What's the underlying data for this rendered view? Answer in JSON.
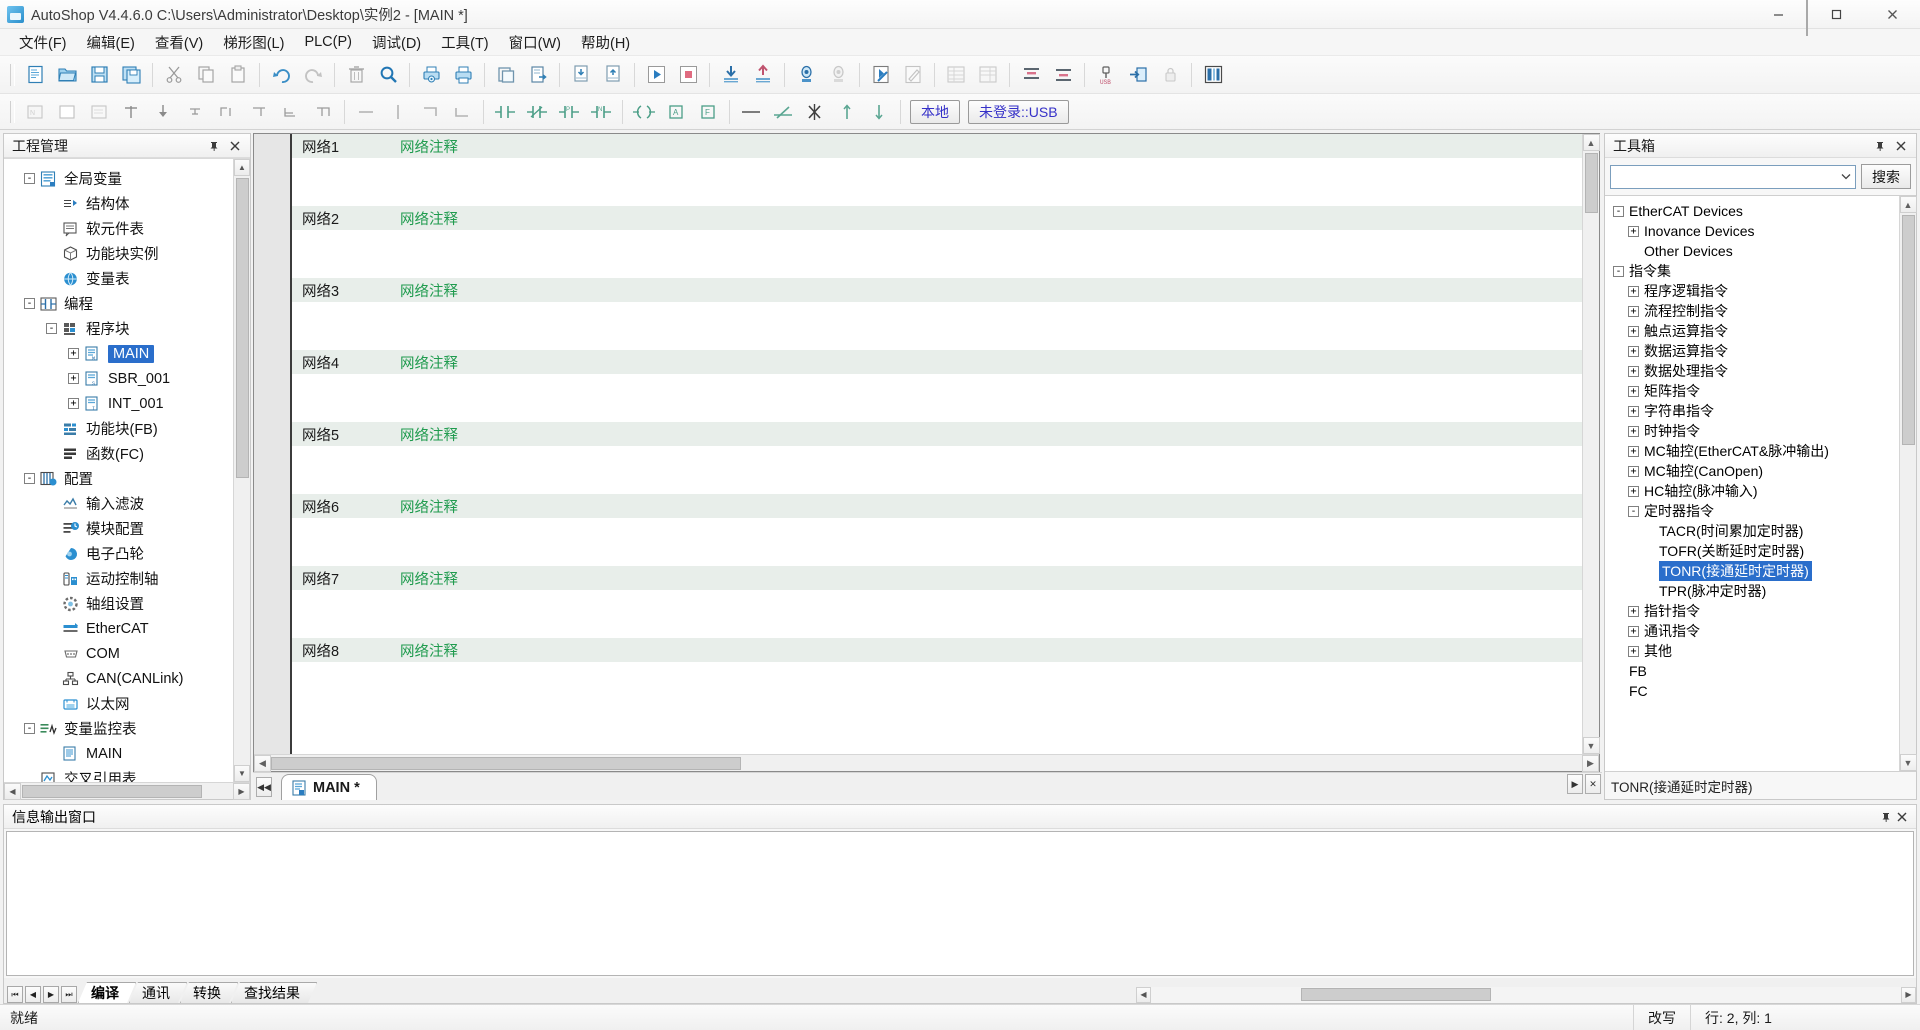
{
  "window": {
    "title": "AutoShop V4.4.6.0  C:\\Users\\Administrator\\Desktop\\实例2 - [MAIN *]",
    "minimize": "—",
    "maximize": "▢",
    "close": "✕"
  },
  "menubar": [
    {
      "label": "文件(F)"
    },
    {
      "label": "编辑(E)"
    },
    {
      "label": "查看(V)"
    },
    {
      "label": "梯形图(L)"
    },
    {
      "label": "PLC(P)"
    },
    {
      "label": "调试(D)"
    },
    {
      "label": "工具(T)"
    },
    {
      "label": "窗口(W)"
    },
    {
      "label": "帮助(H)"
    }
  ],
  "toolbar_main": {
    "icons": [
      "new-file-icon",
      "open-folder-icon",
      "save-icon",
      "save-all-icon",
      "cut-icon",
      "copy-icon",
      "paste-icon",
      "undo-icon",
      "redo-icon",
      "delete-icon",
      "find-icon",
      "print-preview-icon",
      "print-icon",
      "copy-window-icon",
      "export-icon",
      "download-doc-icon",
      "upload-doc-icon",
      "run-icon",
      "stop-icon",
      "download-plc-icon",
      "upload-plc-icon",
      "monitor-icon",
      "monitor-off-icon",
      "compile-icon",
      "edit-mode-icon",
      "table-left-icon",
      "table-right-icon",
      "align-top-icon",
      "align-bottom-icon",
      "usb-connect-icon",
      "login-icon",
      "lock-icon",
      "layout-icon"
    ]
  },
  "toolbar_ladder": {
    "icons": [
      "network-view-icon",
      "block-view-icon",
      "instruction-view-icon",
      "insert-row-icon",
      "insert-down-icon",
      "insert-branch-icon",
      "branch-up-icon",
      "branch-up2-icon",
      "branch-down-icon",
      "branch-down2-icon",
      "hline-icon",
      "vline-icon",
      "corner-icon",
      "corner2-icon",
      "contact-no-icon",
      "contact-nc-icon",
      "contact-p-icon",
      "contact-n-icon",
      "coil-icon",
      "coil-set-icon",
      "box-icon",
      "box-a-icon",
      "box-f-icon",
      "line-icon",
      "del-line-icon",
      "del-branch-icon",
      "arrow-up-icon",
      "arrow-down-icon"
    ],
    "local_button": "本地",
    "login_button": "未登录::USB"
  },
  "project_panel": {
    "title": "工程管理",
    "pin_icon": "pin-icon",
    "close_icon": "close-icon",
    "tree": [
      {
        "label": "全局变量",
        "indent": 0,
        "toggle": "-",
        "icon": "global-var-icon"
      },
      {
        "label": "结构体",
        "indent": 1,
        "toggle": "",
        "icon": "struct-icon"
      },
      {
        "label": "软元件表",
        "indent": 1,
        "toggle": "",
        "icon": "device-table-icon"
      },
      {
        "label": "功能块实例",
        "indent": 1,
        "toggle": "",
        "icon": "fb-instance-icon"
      },
      {
        "label": "变量表",
        "indent": 1,
        "toggle": "",
        "icon": "var-table-icon"
      },
      {
        "label": "编程",
        "indent": 0,
        "toggle": "-",
        "icon": "programming-icon"
      },
      {
        "label": "程序块",
        "indent": 1,
        "toggle": "-",
        "icon": "program-block-icon"
      },
      {
        "label": "MAIN",
        "indent": 2,
        "toggle": "+",
        "icon": "main-pou-icon",
        "selected": true
      },
      {
        "label": "SBR_001",
        "indent": 2,
        "toggle": "+",
        "icon": "sbr-pou-icon"
      },
      {
        "label": "INT_001",
        "indent": 2,
        "toggle": "+",
        "icon": "int-pou-icon"
      },
      {
        "label": "功能块(FB)",
        "indent": 1,
        "toggle": "",
        "icon": "fb-icon"
      },
      {
        "label": "函数(FC)",
        "indent": 1,
        "toggle": "",
        "icon": "fc-icon"
      },
      {
        "label": "配置",
        "indent": 0,
        "toggle": "-",
        "icon": "config-icon"
      },
      {
        "label": "输入滤波",
        "indent": 1,
        "toggle": "",
        "icon": "input-filter-icon"
      },
      {
        "label": "模块配置",
        "indent": 1,
        "toggle": "",
        "icon": "module-config-icon"
      },
      {
        "label": "电子凸轮",
        "indent": 1,
        "toggle": "",
        "icon": "ecam-icon"
      },
      {
        "label": "运动控制轴",
        "indent": 1,
        "toggle": "",
        "icon": "motion-axis-icon"
      },
      {
        "label": "轴组设置",
        "indent": 1,
        "toggle": "",
        "icon": "axis-group-icon"
      },
      {
        "label": "EtherCAT",
        "indent": 1,
        "toggle": "",
        "icon": "ethercat-icon"
      },
      {
        "label": "COM",
        "indent": 1,
        "toggle": "",
        "icon": "com-port-icon"
      },
      {
        "label": "CAN(CANLink)",
        "indent": 1,
        "toggle": "",
        "icon": "can-icon"
      },
      {
        "label": "以太网",
        "indent": 1,
        "toggle": "",
        "icon": "ethernet-icon"
      },
      {
        "label": "变量监控表",
        "indent": 0,
        "toggle": "-",
        "icon": "watch-table-icon"
      },
      {
        "label": "MAIN",
        "indent": 1,
        "toggle": "",
        "icon": "watch-main-icon"
      },
      {
        "label": "交叉引用表",
        "indent": 0,
        "toggle": "",
        "icon": "cross-ref-icon"
      }
    ]
  },
  "editor": {
    "networks": [
      {
        "num": "网络1",
        "comment": "网络注释"
      },
      {
        "num": "网络2",
        "comment": "网络注释"
      },
      {
        "num": "网络3",
        "comment": "网络注释"
      },
      {
        "num": "网络4",
        "comment": "网络注释"
      },
      {
        "num": "网络5",
        "comment": "网络注释"
      },
      {
        "num": "网络6",
        "comment": "网络注释"
      },
      {
        "num": "网络7",
        "comment": "网络注释"
      },
      {
        "num": "网络8",
        "comment": "网络注释"
      }
    ],
    "comment_color": "#1f9b4e",
    "tab_label": "MAIN *",
    "tab_icon": "ladder-doc-icon",
    "nav_first": "◀◀",
    "nav_prev": "◀",
    "nav_next": "▶",
    "nav_last": "▶▶",
    "close_tab": "✕"
  },
  "toolbox_panel": {
    "title": "工具箱",
    "pin_icon": "pin-icon",
    "close_icon": "close-icon",
    "search_placeholder": "",
    "search_value": "",
    "search_button": "搜索",
    "status_text": "TONR(接通延时定时器)",
    "tree": [
      {
        "label": "EtherCAT Devices",
        "indent": 0,
        "toggle": "-"
      },
      {
        "label": "Inovance Devices",
        "indent": 1,
        "toggle": "+"
      },
      {
        "label": "Other Devices",
        "indent": 1,
        "toggle": ""
      },
      {
        "label": "指令集",
        "indent": 0,
        "toggle": "-"
      },
      {
        "label": "程序逻辑指令",
        "indent": 1,
        "toggle": "+"
      },
      {
        "label": "流程控制指令",
        "indent": 1,
        "toggle": "+"
      },
      {
        "label": "触点运算指令",
        "indent": 1,
        "toggle": "+"
      },
      {
        "label": "数据运算指令",
        "indent": 1,
        "toggle": "+"
      },
      {
        "label": "数据处理指令",
        "indent": 1,
        "toggle": "+"
      },
      {
        "label": "矩阵指令",
        "indent": 1,
        "toggle": "+"
      },
      {
        "label": "字符串指令",
        "indent": 1,
        "toggle": "+"
      },
      {
        "label": "时钟指令",
        "indent": 1,
        "toggle": "+"
      },
      {
        "label": "MC轴控(EtherCAT&脉冲输出)",
        "indent": 1,
        "toggle": "+"
      },
      {
        "label": "MC轴控(CanOpen)",
        "indent": 1,
        "toggle": "+"
      },
      {
        "label": "HC轴控(脉冲输入)",
        "indent": 1,
        "toggle": "+"
      },
      {
        "label": "定时器指令",
        "indent": 1,
        "toggle": "-"
      },
      {
        "label": "TACR(时间累加定时器)",
        "indent": 2,
        "toggle": ""
      },
      {
        "label": "TOFR(关断延时定时器)",
        "indent": 2,
        "toggle": ""
      },
      {
        "label": "TONR(接通延时定时器)",
        "indent": 2,
        "toggle": "",
        "selected": true
      },
      {
        "label": "TPR(脉冲定时器)",
        "indent": 2,
        "toggle": ""
      },
      {
        "label": "指针指令",
        "indent": 1,
        "toggle": "+"
      },
      {
        "label": "通讯指令",
        "indent": 1,
        "toggle": "+"
      },
      {
        "label": "其他",
        "indent": 1,
        "toggle": "+"
      },
      {
        "label": "FB",
        "indent": 0,
        "toggle": ""
      },
      {
        "label": "FC",
        "indent": 0,
        "toggle": ""
      }
    ]
  },
  "output_panel": {
    "title": "信息输出窗口",
    "pin_icon": "pin-icon",
    "close_icon": "close-icon",
    "content": "",
    "nav": [
      "⏮",
      "◀",
      "▶",
      "⏭"
    ],
    "tabs": [
      {
        "label": "编译",
        "active": true
      },
      {
        "label": "通讯",
        "active": false
      },
      {
        "label": "转换",
        "active": false
      },
      {
        "label": "查找结果",
        "active": false
      }
    ]
  },
  "statusbar": {
    "ready": "就绪",
    "overwrite": "改写",
    "position": "行:  2, 列:  1"
  }
}
